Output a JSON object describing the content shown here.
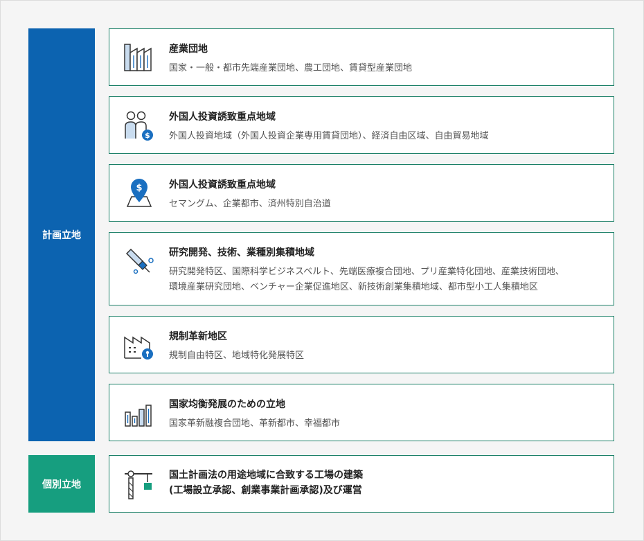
{
  "sections": {
    "planned": {
      "label": "計画立地"
    },
    "individual": {
      "label": "個別立地"
    }
  },
  "colors": {
    "planned": "#0c63b0",
    "individual": "#169e7f",
    "card_border": "#1a7f66"
  },
  "cards": [
    {
      "icon": "industrial-building-icon",
      "title": "産業団地",
      "desc": [
        "国家・一般・都市先端産業団地、農工団地、賃貸型産業団地"
      ]
    },
    {
      "icon": "investor-people-icon",
      "title": "外国人投資誘致重点地域",
      "desc": [
        "外国人投資地域（外国人投資企業専用賃貸団地）、経済自由区域、自由貿易地域"
      ]
    },
    {
      "icon": "location-dollar-icon",
      "title": "外国人投資誘致重点地域",
      "desc": [
        "セマングム、企業都市、済州特別自治道"
      ]
    },
    {
      "icon": "research-pipette-icon",
      "title": "研究開発、技術、業種別集積地域",
      "desc": [
        "研究開発特区、国際科学ビジネスベルト、先端医療複合団地、プリ産業特化団地、産業技術団地、",
        "環境産業研究団地、ベンチャー企業促進地区、新技術創業集積地域、都市型小工人集積地区"
      ]
    },
    {
      "icon": "factory-lock-icon",
      "title": "規制革新地区",
      "desc": [
        "規制自由特区、地域特化発展特区"
      ]
    },
    {
      "icon": "balanced-bars-icon",
      "title": "国家均衡発展のための立地",
      "desc": [
        "国家革新融複合団地、革新都市、幸福都市"
      ]
    },
    {
      "icon": "construction-crane-icon",
      "title_lines": [
        "国土計画法の用途地域に合致する工場の建築",
        "(工場設立承認、創業事業計画承認)及び運営"
      ]
    }
  ]
}
